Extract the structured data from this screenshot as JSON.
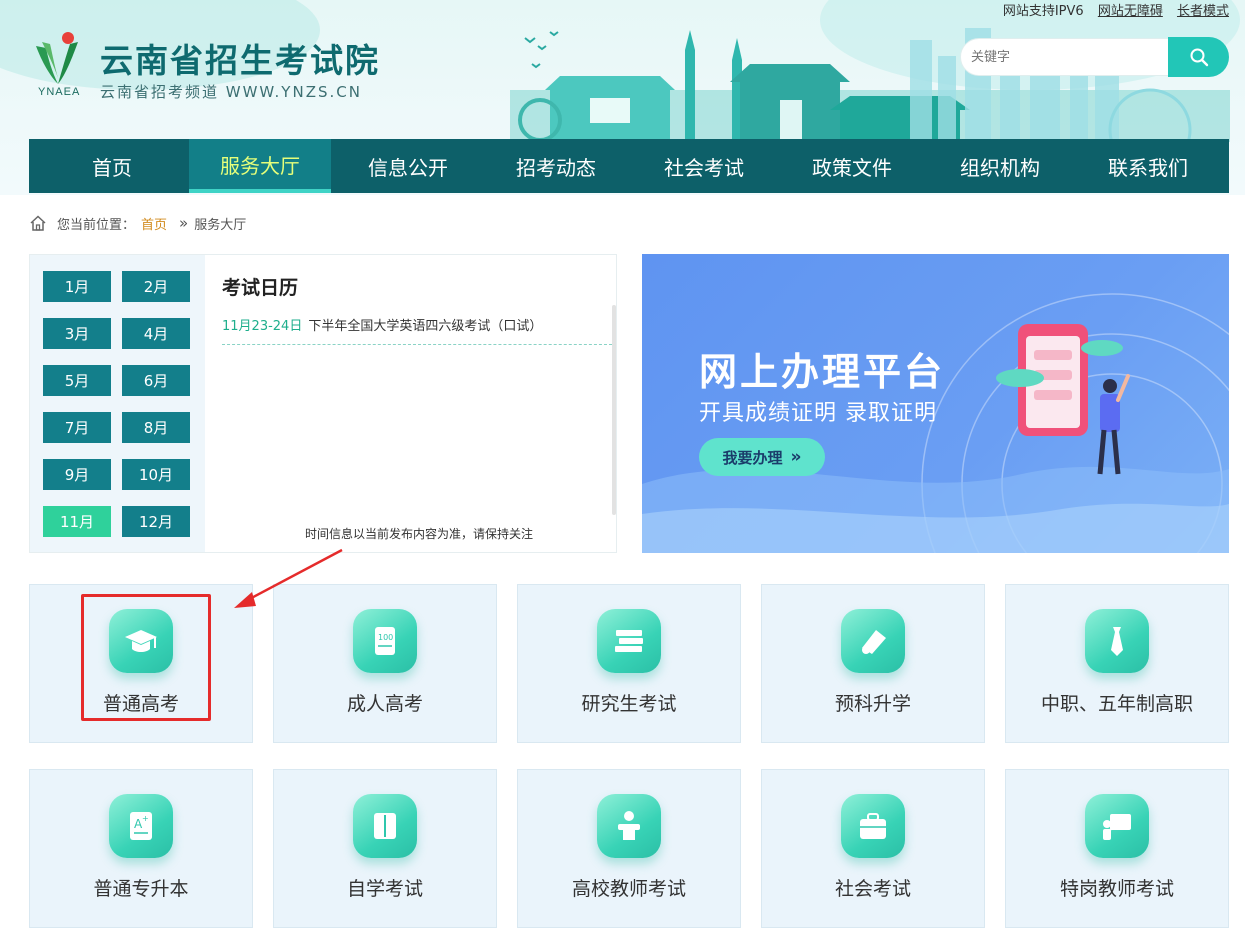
{
  "header": {
    "site_title": "云南省招生考试院",
    "site_subtitle": "云南省招考频道 WWW.YNZS.CN",
    "logo_abbr": "YNAEA",
    "top_links": [
      "网站支持IPV6",
      "网站无障碍",
      "长者模式"
    ],
    "search_placeholder": "关键字"
  },
  "nav": {
    "items": [
      "首页",
      "服务大厅",
      "信息公开",
      "招考动态",
      "社会考试",
      "政策文件",
      "组织机构",
      "联系我们"
    ],
    "active_index": 1
  },
  "breadcrumb": {
    "prefix": "您当前位置：",
    "home": "首页",
    "separator": "»",
    "current": "服务大厅"
  },
  "calendar": {
    "months": [
      "1月",
      "2月",
      "3月",
      "4月",
      "5月",
      "6月",
      "7月",
      "8月",
      "9月",
      "10月",
      "11月",
      "12月"
    ],
    "active_month": "11月",
    "title": "考试日历",
    "events": [
      {
        "date": "11月23-24日",
        "text": "下半年全国大学英语四六级考试（口试）"
      }
    ],
    "note": "时间信息以当前发布内容为准，请保持关注"
  },
  "banner": {
    "title": "网上办理平台",
    "subtitle": "开具成绩证明 录取证明",
    "button": "我要办理"
  },
  "tiles": [
    {
      "label": "普通高考",
      "icon": "graduation-cap-icon"
    },
    {
      "label": "成人高考",
      "icon": "certificate-scroll-icon"
    },
    {
      "label": "研究生考试",
      "icon": "books-icon"
    },
    {
      "label": "预科升学",
      "icon": "diploma-icon"
    },
    {
      "label": "中职、五年制高职",
      "icon": "tie-icon"
    },
    {
      "label": "普通专升本",
      "icon": "grade-a-plus-icon"
    },
    {
      "label": "自学考试",
      "icon": "open-book-icon"
    },
    {
      "label": "高校教师考试",
      "icon": "teacher-podium-icon"
    },
    {
      "label": "社会考试",
      "icon": "briefcase-icon"
    },
    {
      "label": "特岗教师考试",
      "icon": "blackboard-teacher-icon"
    }
  ],
  "colors": {
    "nav_bg": "#0d6069",
    "accent": "#22c6b7",
    "month_bg": "#137f8b",
    "month_active": "#2fd19b",
    "highlight": "#e52b2b"
  }
}
